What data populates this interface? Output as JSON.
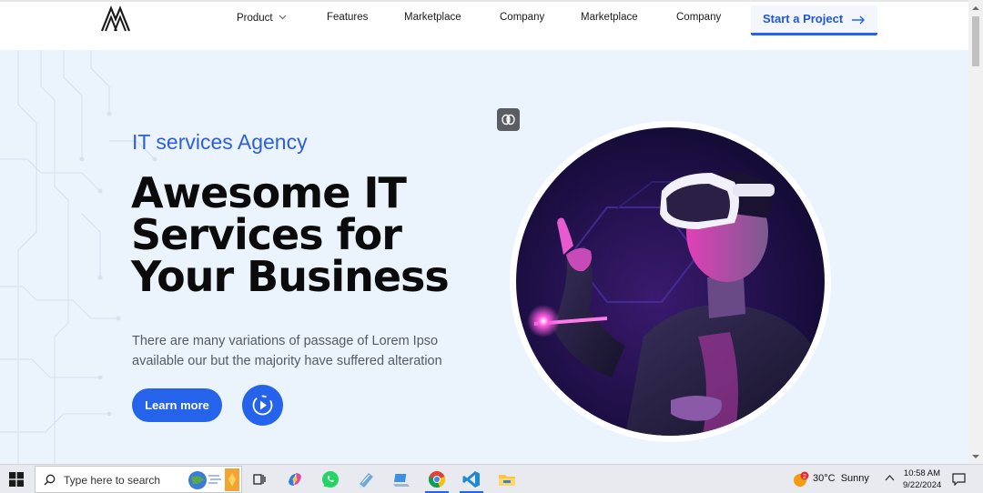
{
  "header": {
    "nav": [
      {
        "label": "Product",
        "has_dropdown": true
      },
      {
        "label": "Features"
      },
      {
        "label": "Marketplace"
      },
      {
        "label": "Company"
      },
      {
        "label": "Marketplace"
      },
      {
        "label": "Company"
      }
    ],
    "cta_label": "Start a Project"
  },
  "hero": {
    "tagline": "IT services Agency",
    "headline_lines": [
      "Awesome IT",
      "Services for",
      "Your Business"
    ],
    "description_lines": [
      "There are many variations of passage of Lorem Ipso",
      "available our but the majority have suffered alteration"
    ],
    "learn_more_label": "Learn more",
    "play_icon": "play-circle-icon",
    "brain_icon": "brain-icon",
    "image_subject": "vr-headset-person-image"
  },
  "taskbar": {
    "search_placeholder": "Type here to search",
    "apps": [
      "task-view-icon",
      "copilot-icon",
      "whatsapp-icon",
      "notepad-icon",
      "laptop-icon",
      "chrome-icon",
      "vscode-icon",
      "file-explorer-icon"
    ],
    "weather": {
      "badge": "2",
      "temp": "30°C",
      "condition": "Sunny"
    },
    "time": "10:58 AM",
    "date": "9/22/2024"
  },
  "colors": {
    "accent": "#2563eb",
    "hero_bg": "#ebf3fd",
    "tagline": "#2d5fd9"
  }
}
